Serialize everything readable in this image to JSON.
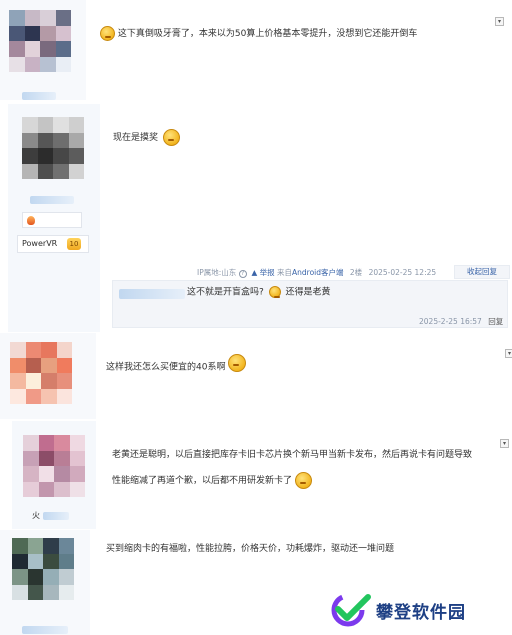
{
  "posts": [
    {
      "text": "这下真倒吸牙膏了，本来以为50算上价格基本零提升，没想到它还能开倒车",
      "dropdown": "▾"
    },
    {
      "text": "现在是摸奖",
      "badge": "PowerVR",
      "level": "10"
    },
    {
      "text": "这样我还怎么买便宜的40系啊",
      "dropdown": "▾"
    },
    {
      "text_line1": "老黄还是聪明，以后直接把库存卡旧卡芯片换个新马甲当新卡发布，然后再说卡有问题导致",
      "text_line2": "性能缩减了再道个歉，以后都不用研发新卡了",
      "name_fragment": "火",
      "dropdown": "▾"
    },
    {
      "text": "买到缩肉卡的有福啦，性能拉胯，价格天价，功耗爆炸，驱动还一堆问题"
    }
  ],
  "post_meta": {
    "ip": "IP属地:山东",
    "report": "举报",
    "from_prefix": "来自",
    "from_client": "Android客户端",
    "floor": "2楼",
    "datetime": "2025-02-25 12:25",
    "collapse": "收起回复"
  },
  "reply": {
    "text_a": "这不就是开盲盒吗?",
    "text_b": "还得是老黄",
    "datetime": "2025-2-25 16:57",
    "reply_label": "回复"
  },
  "watermark": {
    "text": "攀登软件园"
  },
  "colors": {
    "link": "#3a64a8",
    "meta": "#8a96a8",
    "sidebar": "#f5f8fc",
    "watermark": "#1d3f84"
  }
}
